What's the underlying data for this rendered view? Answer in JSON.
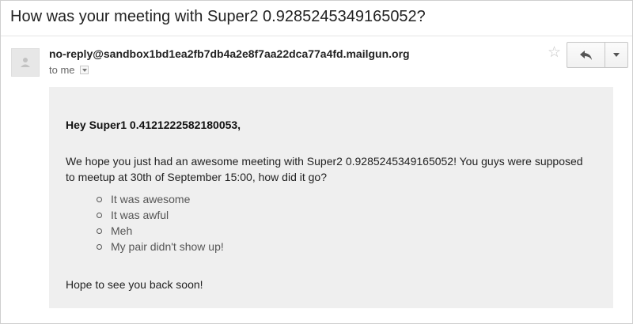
{
  "email": {
    "subject": "How was your meeting with Super2 0.9285245349165052?",
    "sender": "no-reply@sandbox1bd1ea2fb7db4a2e8f7aa22dca77a4fd.mailgun.org",
    "recipient_label": "to me",
    "body": {
      "greeting": "Hey Super1 0.4121222582180053,",
      "paragraph": "We hope you just had an awesome meeting with Super2 0.9285245349165052! You guys were supposed to meetup at 30th of September 15:00, how did it go?",
      "options": [
        "It was awesome",
        "It was awful",
        "Meh",
        "My pair didn't show up!"
      ],
      "closing": "Hope to see you back soon!"
    }
  },
  "icons": {
    "avatar": "person-silhouette-icon",
    "star": "star-outline-icon",
    "reply": "reply-arrow-icon",
    "more": "chevron-down-icon",
    "recipient_dropdown": "caret-down-icon"
  },
  "colors": {
    "body_background": "#efefef",
    "link_option_text": "#555555",
    "star_outline": "#c6c6c6"
  }
}
